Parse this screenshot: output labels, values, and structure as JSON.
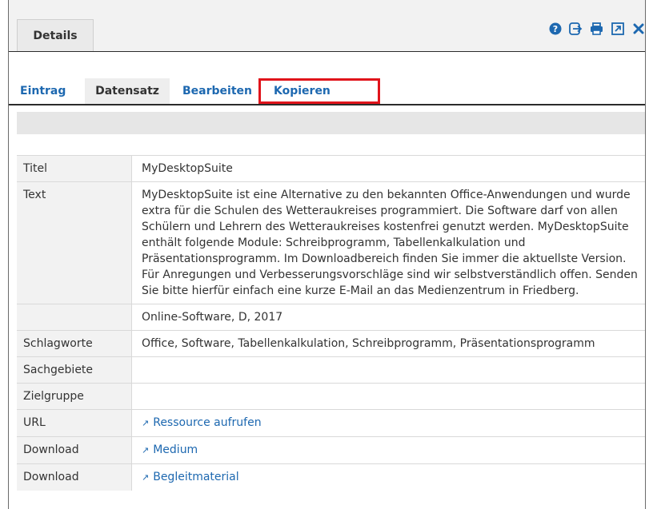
{
  "panel": {
    "tab_label": "Details"
  },
  "toolbar": {
    "icons": [
      "help-icon",
      "export-icon",
      "print-icon",
      "open-external-icon",
      "close-icon"
    ],
    "accent": "#1d68b0"
  },
  "tabs": {
    "eintrag": "Eintrag",
    "datensatz": "Datensatz",
    "bearbeiten": "Bearbeiten",
    "kopieren": "Kopieren"
  },
  "rows": {
    "titel": {
      "label": "Titel",
      "value": "MyDesktopSuite"
    },
    "text": {
      "label": "Text",
      "value": "MyDesktopSuite ist eine Alternative zu den bekannten Office-Anwendungen und wurde extra für die Schulen des Wetteraukreises programmiert. Die Software darf von allen Schülern und Lehrern des Wetteraukreises kostenfrei genutzt werden. MyDesktopSuite enthält folgende Module: Schreibprogramm, Tabellenkalkulation und Präsentationsprogramm. Im Downloadbereich finden Sie immer die aktuellste Version. Für Anregungen und Verbesserungsvorschläge sind wir selbstverständlich offen. Senden Sie bitte hierfür einfach eine kurze E-Mail an das Medienzentrum in Friedberg."
    },
    "info": {
      "label": "",
      "value": "Online-Software, D, 2017"
    },
    "schlagworte": {
      "label": "Schlagworte",
      "value": "Office, Software, Tabellenkalkulation, Schreibprogramm, Präsentationsprogramm"
    },
    "sachgebiete": {
      "label": "Sachgebiete",
      "value": ""
    },
    "zielgruppe": {
      "label": "Zielgruppe",
      "value": ""
    },
    "url": {
      "label": "URL",
      "link": "Ressource aufrufen"
    },
    "download1": {
      "label": "Download",
      "link": "Medium"
    },
    "download2": {
      "label": "Download",
      "link": "Begleitmaterial"
    }
  }
}
